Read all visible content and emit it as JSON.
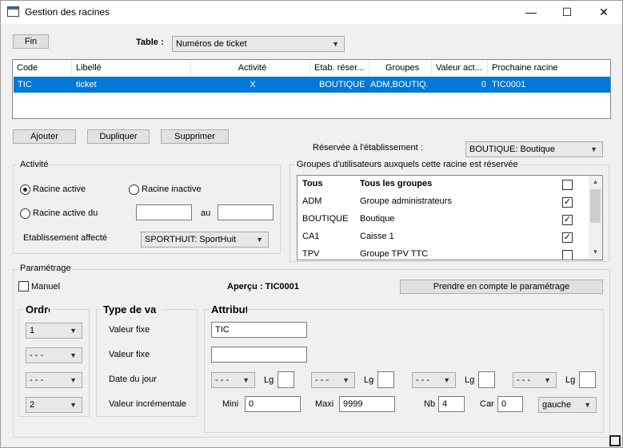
{
  "window": {
    "title": "Gestion des racines",
    "minimize": "—",
    "maximize": "☐",
    "close": "✕"
  },
  "toolbar": {
    "fin_label": "Fin",
    "table_label": "Table :",
    "table_value": "Numéros de ticket"
  },
  "grid": {
    "columns": [
      "Code",
      "Libellé",
      "Activité",
      "Etab. réser...",
      "Groupes",
      "Valeur act...",
      "Prochaine racine"
    ],
    "rows": [
      [
        "TIC",
        "ticket",
        "X",
        "BOUTIQUE",
        "ADM,BOUTIQ...",
        "0",
        "TIC0001"
      ]
    ]
  },
  "actions": {
    "ajouter": "Ajouter",
    "dupliquer": "Dupliquer",
    "supprimer": "Supprimer"
  },
  "reserve": {
    "label": "Réservée à l'établissement :",
    "value": "BOUTIQUE: Boutique"
  },
  "activite": {
    "title": "Activité",
    "racine_active": "Racine active",
    "racine_inactive": "Racine inactive",
    "racine_active_du": "Racine active du",
    "au": "au",
    "date_from": "",
    "date_to": "",
    "etab_label": "Etablissement affecté",
    "etab_value": "SPORTHUIT: SportHuit"
  },
  "groupes": {
    "title": "Groupes d'utilisateurs auxquels cette racine est réservée",
    "rows": [
      {
        "code": "Tous",
        "name": "Tous les groupes",
        "checked": false,
        "bold": true
      },
      {
        "code": "ADM",
        "name": "Groupe administrateurs",
        "checked": true
      },
      {
        "code": "BOUTIQUE",
        "name": "Boutique",
        "checked": true
      },
      {
        "code": "CA1",
        "name": "Caisse 1",
        "checked": true
      },
      {
        "code": "TPV",
        "name": "Groupe TPV TTC",
        "checked": false
      }
    ]
  },
  "parametrage": {
    "title": "Paramétrage",
    "manuel": "Manuel",
    "apercu": "Aperçu : TIC0001",
    "prendre_btn": "Prendre en compte le paramétrage",
    "ordre_title": "Ordre",
    "type_title": "Type de va",
    "attribut_title": "Attribut",
    "ordres": [
      "1",
      "- - -",
      "- - -",
      "2"
    ],
    "types": [
      "Valeur fixe",
      "Valeur fixe",
      "Date du jour",
      "Valeur incrémentale"
    ],
    "attr1": "TIC",
    "attr2": "",
    "date_parts": [
      {
        "value": "- - -",
        "lg_label": "Lg",
        "lg": ""
      },
      {
        "value": "- - -",
        "lg_label": "Lg",
        "lg": ""
      },
      {
        "value": "- - -",
        "lg_label": "Lg",
        "lg": ""
      },
      {
        "value": "- - -",
        "lg_label": "Lg",
        "lg": ""
      }
    ],
    "mini_label": "Mini",
    "mini": "0",
    "maxi_label": "Maxi",
    "maxi": "9999",
    "nb_label": "Nb",
    "nb": "4",
    "car_label": "Car",
    "car": "0",
    "align": "gauche"
  }
}
